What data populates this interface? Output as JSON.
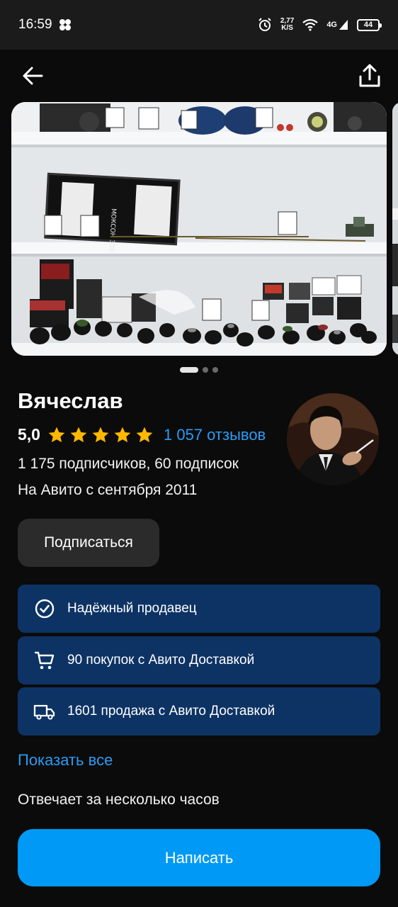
{
  "status_bar": {
    "time": "16:59",
    "net_speed_value": "2,77",
    "net_speed_unit": "K/S",
    "network": "4G",
    "battery": "44"
  },
  "header": {
    "back_icon": "arrow-left-icon",
    "share_icon": "share-icon"
  },
  "gallery": {
    "photo_count": 3,
    "active_index": 0,
    "shelf_label": "МОКСОН 300"
  },
  "profile": {
    "name": "Вячеслав",
    "rating": "5,0",
    "stars": 5,
    "reviews": "1 057 отзывов",
    "subscribers": "1 175 подписчиков, 60 подписок",
    "since": "На Авито с сентября 2011",
    "subscribe_label": "Подписаться"
  },
  "badges": [
    {
      "icon": "check-circle-icon",
      "text": "Надёжный продавец"
    },
    {
      "icon": "cart-icon",
      "text": "90 покупок с Авито Доставкой"
    },
    {
      "icon": "truck-icon",
      "text": "1601 продажа с Авито Доставкой"
    }
  ],
  "show_all": "Показать все",
  "response_time": "Отвечает за несколько часов",
  "write_button": "Написать",
  "colors": {
    "background": "#0b0b0b",
    "accent": "#0099f5",
    "link": "#2b9bf4",
    "badge_bg": "#0d3364",
    "star": "#ffb800"
  }
}
